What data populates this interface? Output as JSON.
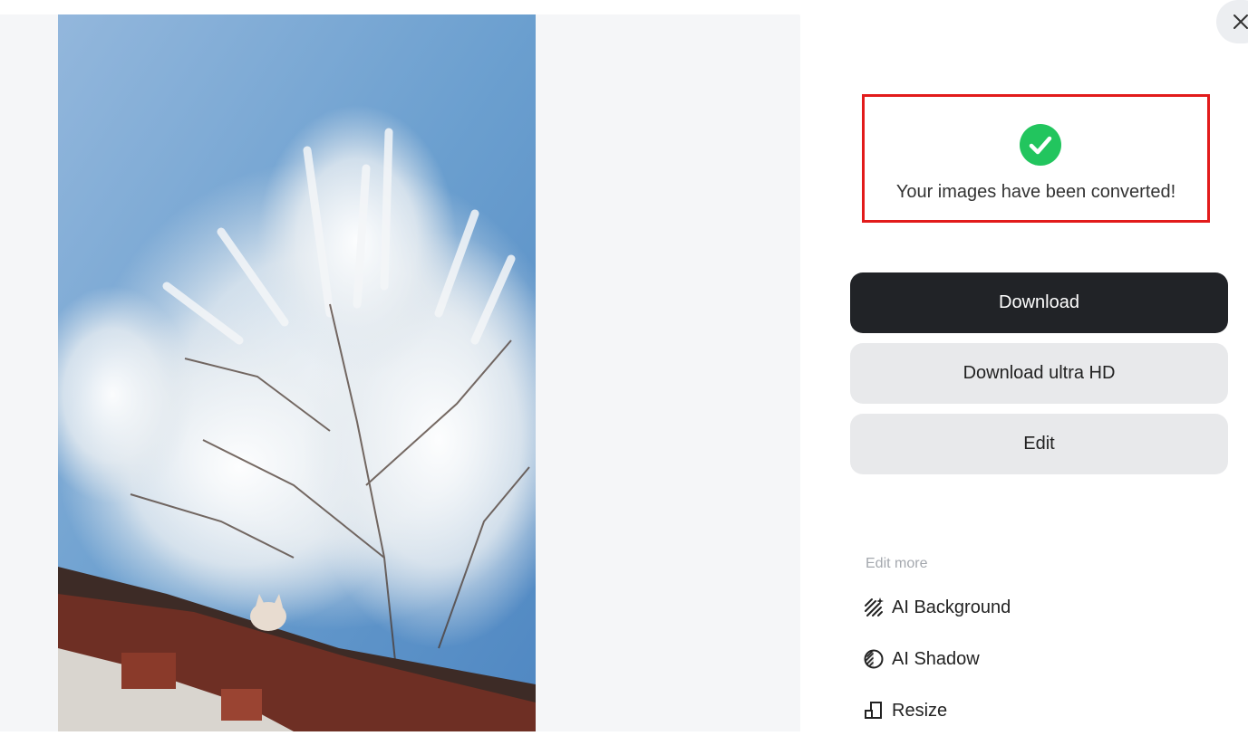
{
  "dialog": {
    "close_label": "×",
    "success_message": "Your images have been converted!",
    "buttons": {
      "download": "Download",
      "download_hd": "Download ultra HD",
      "edit": "Edit"
    },
    "edit_more": {
      "heading": "Edit more",
      "items": [
        {
          "label": "AI Background",
          "icon": "ai-background-icon"
        },
        {
          "label": "AI Shadow",
          "icon": "ai-shadow-icon"
        },
        {
          "label": "Resize",
          "icon": "resize-icon"
        }
      ]
    }
  },
  "colors": {
    "primary_button": "#212327",
    "secondary_button": "#e8e9eb",
    "success_green": "#22c55e",
    "highlight_border": "#e21b1b"
  }
}
